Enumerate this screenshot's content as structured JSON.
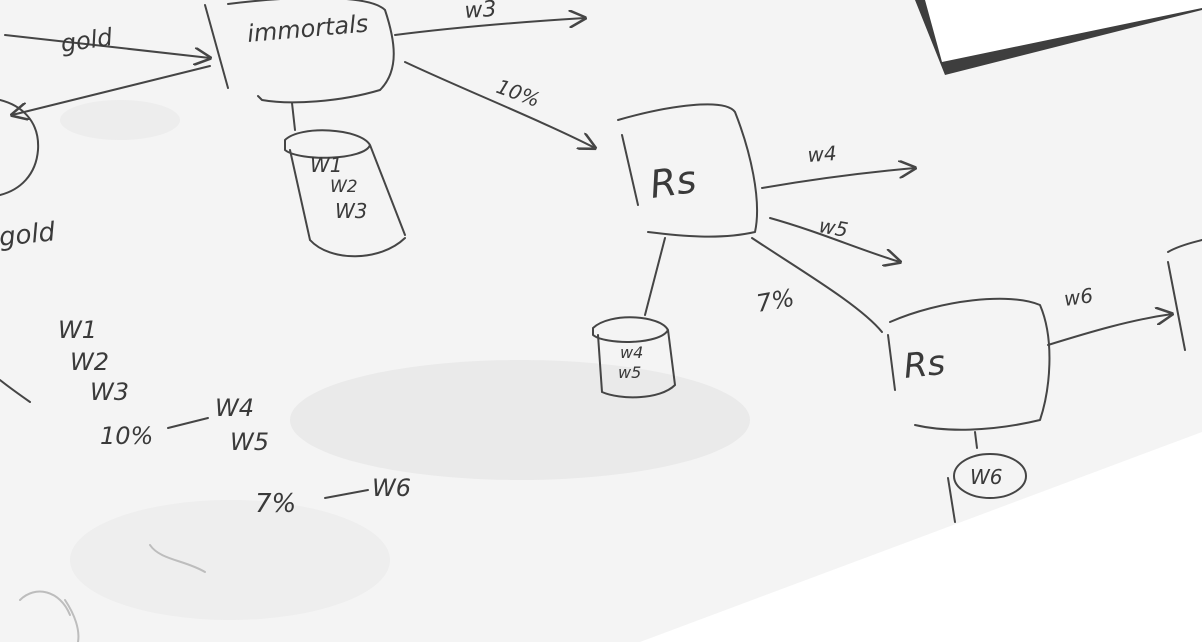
{
  "colors": {
    "board": "#f4f4f4",
    "ink": "#454545",
    "corner": "#3e3e3e",
    "edge": "#ffffff"
  },
  "labels": {
    "gold_top": "gold",
    "gold_left": "gold",
    "immortals": "immortals",
    "w3_arrow": "w3",
    "pct_10_arrow": "10%",
    "store1_w1": "W1",
    "store1_w2": "W2",
    "store1_w3": "W3",
    "rs_1": "Rs",
    "w4_arrow": "w4",
    "w5_arrow": "w5",
    "store2_w4": "w4",
    "store2_w5": "w5",
    "pct_7_arrow": "7%",
    "rs_2": "Rs",
    "w6_arrow": "w6",
    "w6_circle": "W6"
  },
  "notes": {
    "w1": "W1",
    "w2": "W2",
    "w3": "W3",
    "pct_10": "10%",
    "w4": "W4",
    "w5": "W5",
    "pct_7": "7%",
    "w6": "W6"
  }
}
